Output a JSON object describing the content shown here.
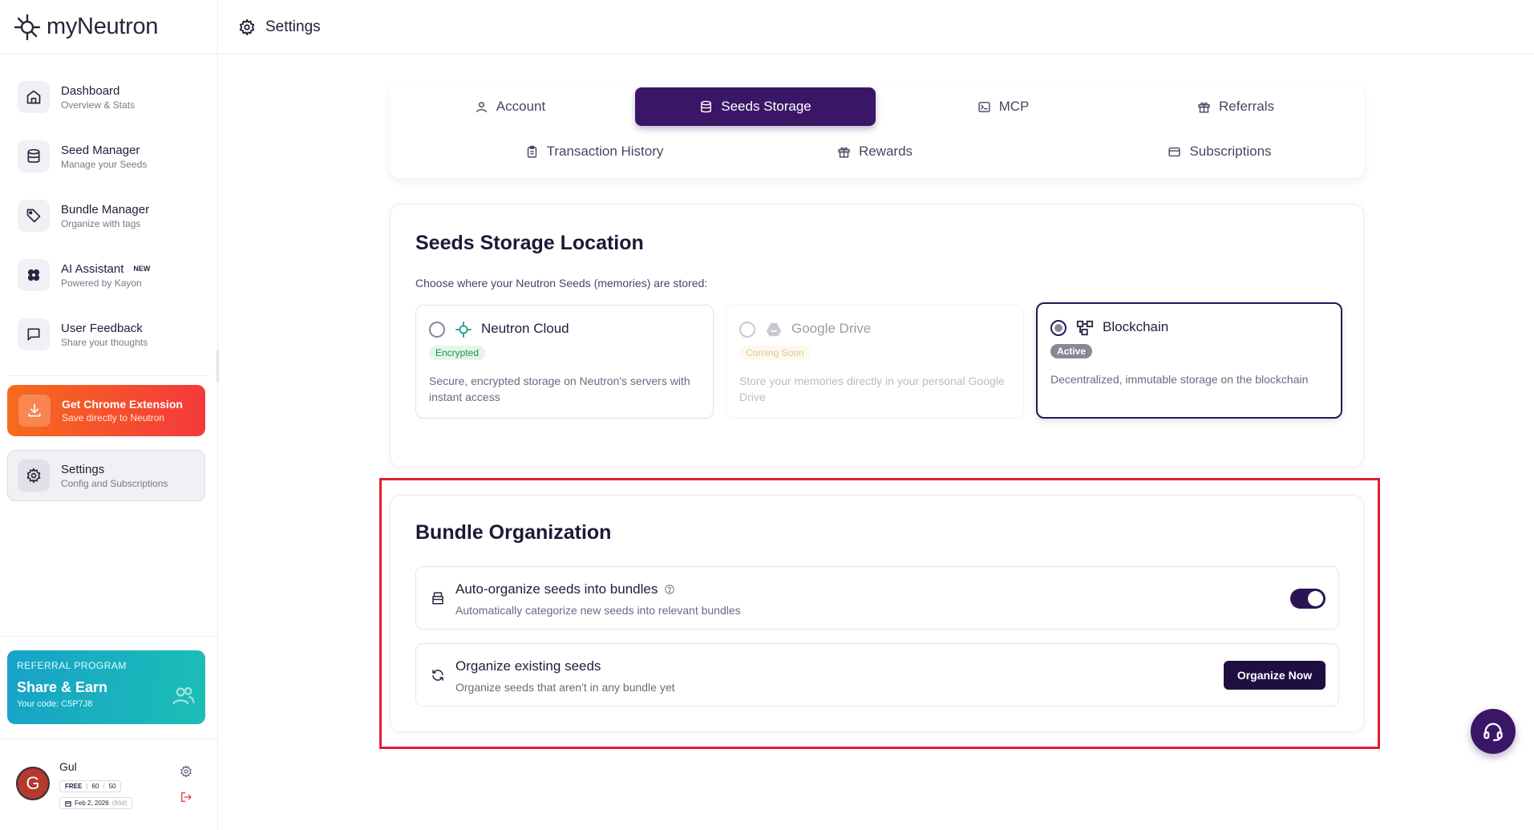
{
  "app": {
    "name": "myNeutron",
    "colors": {
      "accent": "#3a1766",
      "highlight": "#e02030",
      "chrome_from": "#f76b1c",
      "chrome_to": "#f4393c",
      "referral_from": "#18a2c8",
      "referral_to": "#1bbfb5"
    }
  },
  "topbar": {
    "icon": "gear-icon",
    "title": "Settings"
  },
  "sidebar": {
    "items": [
      {
        "icon": "home-icon",
        "title": "Dashboard",
        "sub": "Overview & Stats"
      },
      {
        "icon": "database-icon",
        "title": "Seed Manager",
        "sub": "Manage your Seeds"
      },
      {
        "icon": "tag-icon",
        "title": "Bundle Manager",
        "sub": "Organize with tags"
      },
      {
        "icon": "ai-assistant-icon",
        "title": "AI Assistant",
        "badge": "NEW",
        "sub": "Powered by Kayon"
      },
      {
        "icon": "message-square-icon",
        "title": "User Feedback",
        "sub": "Share your thoughts"
      }
    ],
    "chrome": {
      "icon": "download-icon",
      "title": "Get Chrome Extension",
      "sub": "Save directly to Neutron"
    },
    "settings": {
      "icon": "gear-icon",
      "title": "Settings",
      "sub": "Config and Subscriptions"
    },
    "referral": {
      "label": "REFERRAL PROGRAM",
      "title": "Share & Earn",
      "code": "Your code: C5P7J8",
      "icon": "users-icon"
    },
    "user": {
      "initial": "G",
      "name": "Gul",
      "plan": "FREE",
      "used": "60",
      "limit": "50",
      "date": "Feb 2, 2026",
      "date_note": "(86d)"
    }
  },
  "tabs": [
    {
      "label": "Account",
      "icon": "user-icon",
      "active": false
    },
    {
      "label": "Seeds Storage",
      "icon": "database-icon",
      "active": true
    },
    {
      "label": "MCP",
      "icon": "terminal-icon",
      "active": false
    },
    {
      "label": "Referrals",
      "icon": "gift-icon",
      "active": false
    },
    {
      "label": "Transaction History",
      "icon": "clipboard-icon",
      "active": false
    },
    {
      "label": "Rewards",
      "icon": "gift-icon",
      "active": false
    },
    {
      "label": "Subscriptions",
      "icon": "credit-card-icon",
      "active": false
    }
  ],
  "storage": {
    "title": "Seeds Storage Location",
    "description": "Choose where your Neutron Seeds (memories) are stored:",
    "options": [
      {
        "name": "Neutron Cloud",
        "icon": "neutron-cloud-icon",
        "badge": "Encrypted",
        "text": "Secure, encrypted storage on Neutron's servers with instant access",
        "state": "available"
      },
      {
        "name": "Google Drive",
        "icon": "google-drive-icon",
        "badge": "Coming Soon",
        "text": "Store your memories directly in your personal Google Drive",
        "state": "disabled"
      },
      {
        "name": "Blockchain",
        "icon": "blockchain-icon",
        "badge": "Active",
        "text": "Decentralized, immutable storage on the blockchain",
        "state": "selected"
      }
    ]
  },
  "bundle": {
    "title": "Bundle Organization",
    "auto": {
      "icon": "archive-icon",
      "title": "Auto-organize seeds into bundles",
      "help_icon": "help-circle-icon",
      "sub": "Automatically categorize new seeds into relevant bundles",
      "enabled": true
    },
    "existing": {
      "icon": "refresh-icon",
      "title": "Organize existing seeds",
      "sub": "Organize seeds that aren't in any bundle yet",
      "button": "Organize Now"
    }
  },
  "support": {
    "icon": "headset-icon"
  }
}
